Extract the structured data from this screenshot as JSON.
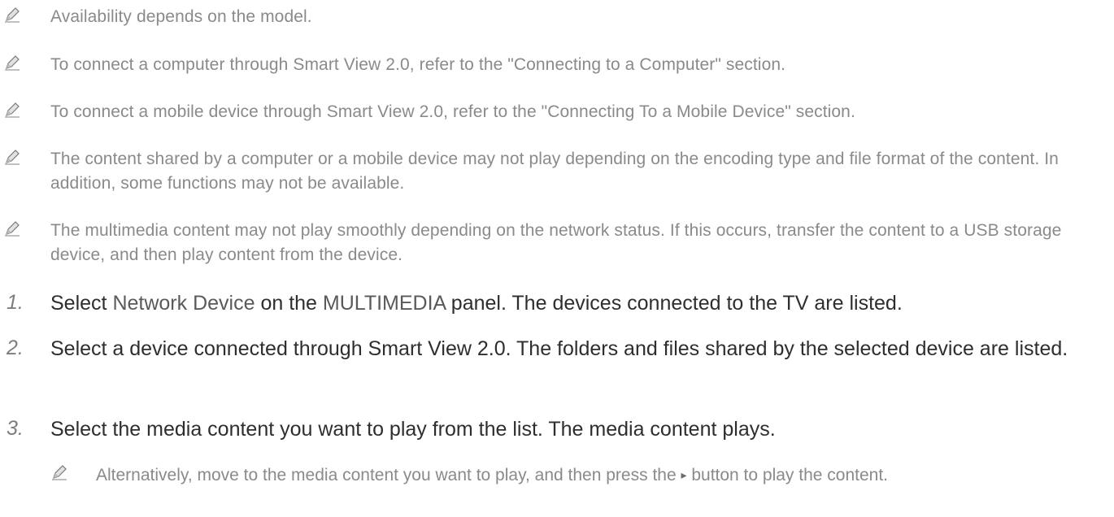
{
  "notes": [
    "Availability depends on the model.",
    "To connect a computer through Smart View 2.0, refer to the \"Connecting to a Computer\" section.",
    "To connect a mobile device through Smart View 2.0, refer to the \"Connecting To a Mobile Device\" section.",
    "The content shared by a computer or a mobile device may not play depending on the encoding type and file format of the content. In addition, some functions may not be available.",
    "The multimedia content may not play smoothly depending on the network status. If this occurs, transfer the content to a USB storage device, and then play content from the device."
  ],
  "steps": [
    {
      "number": "1.",
      "pre": "Select ",
      "term1": "Network Device",
      "mid": " on the ",
      "term2": "MULTIMEDIA",
      "post": " panel. The devices connected to the TV are listed."
    },
    {
      "number": "2.",
      "text": "Select a device connected through Smart View 2.0. The folders and files shared by the selected device are listed."
    },
    {
      "number": "3.",
      "text": "Select the media content you want to play from the list. The media content plays."
    }
  ],
  "subnote": {
    "pre": "Alternatively, move to the media content you want to play, and then press the ",
    "button_glyph": "▸",
    "post": " button to play the content."
  },
  "icons": {
    "note_icon": "pencil-icon"
  },
  "colors": {
    "note_text": "#8a8a8a",
    "step_text": "#2e2e2e",
    "step_number": "#7d7d7d",
    "highlight_term": "#5a5a5a"
  }
}
